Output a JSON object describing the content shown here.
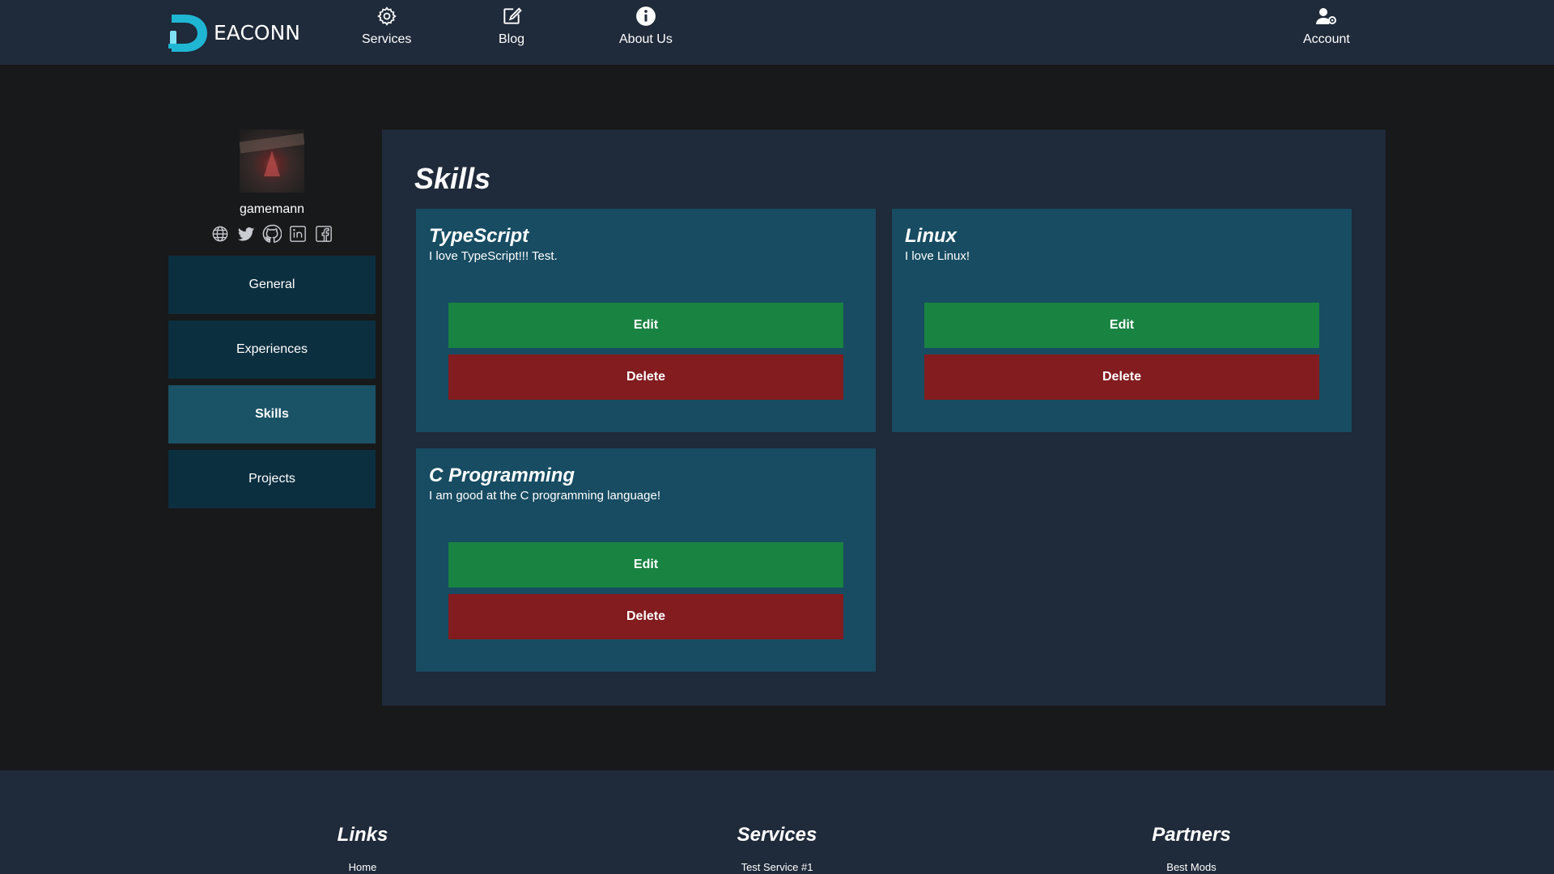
{
  "brand": {
    "logo_text": "EACONN",
    "logo_letter": "D"
  },
  "nav": {
    "services": "Services",
    "blog": "Blog",
    "about": "About Us",
    "account": "Account"
  },
  "profile": {
    "username": "gamemann",
    "socials": [
      "globe-icon",
      "twitter-icon",
      "github-icon",
      "linkedin-icon",
      "facebook-icon"
    ]
  },
  "sidebar": {
    "items": [
      {
        "label": "General",
        "active": false
      },
      {
        "label": "Experiences",
        "active": false
      },
      {
        "label": "Skills",
        "active": true
      },
      {
        "label": "Projects",
        "active": false
      }
    ]
  },
  "main": {
    "title": "Skills",
    "skills": [
      {
        "name": "TypeScript",
        "description": "I love TypeScript!!! Test.",
        "edit_label": "Edit",
        "delete_label": "Delete"
      },
      {
        "name": "Linux",
        "description": "I love Linux!",
        "edit_label": "Edit",
        "delete_label": "Delete"
      },
      {
        "name": "C Programming",
        "description": "I am good at the C programming language!",
        "edit_label": "Edit",
        "delete_label": "Delete"
      }
    ]
  },
  "footer": {
    "columns": [
      {
        "title": "Links",
        "first_link": "Home"
      },
      {
        "title": "Services",
        "first_link": "Test Service #1"
      },
      {
        "title": "Partners",
        "first_link": "Best Mods"
      }
    ]
  },
  "colors": {
    "header_bg": "#1f2a3a",
    "page_bg": "#18191b",
    "card_bg": "#174c62",
    "sidebar_btn": "#0c2f40",
    "sidebar_active": "#1a5266",
    "edit_green": "#198342",
    "delete_red": "#821c1f",
    "logo_cyan": "#1fb6d4"
  }
}
